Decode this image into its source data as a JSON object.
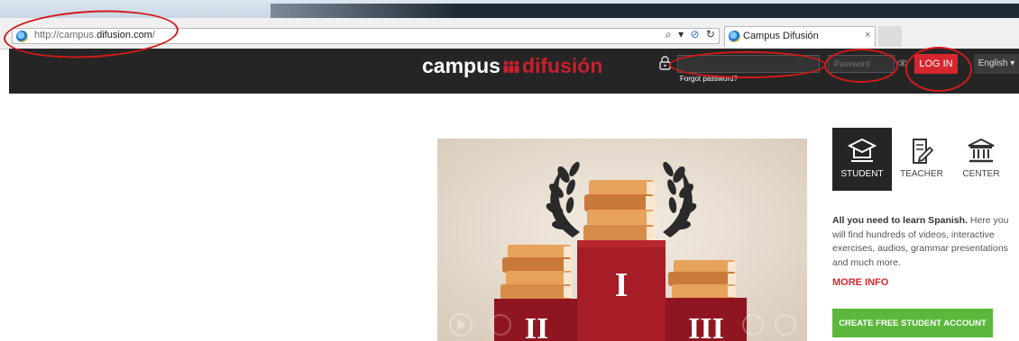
{
  "browser": {
    "url_prefix": "http://campus.",
    "url_domain": "difusion.com",
    "url_suffix": "/",
    "tab_title": "Campus Difusión",
    "search_glyph": "⌕",
    "dropdown_glyph": "▾",
    "stop_glyph": "⊘",
    "refresh_glyph": "↻",
    "close_glyph": "×"
  },
  "header": {
    "logo_part1": "campus",
    "logo_part2": "difusión",
    "username_placeholder": "",
    "forgot_password": "Forgot password?",
    "password_placeholder": "Password",
    "login_label": "LOG IN",
    "language_label": "English ▾"
  },
  "roles": [
    {
      "label": "STUDENT",
      "icon": "graduation-cap-icon",
      "active": true
    },
    {
      "label": "TEACHER",
      "icon": "pencil-document-icon",
      "active": false
    },
    {
      "label": "CENTER",
      "icon": "institution-icon",
      "active": false
    }
  ],
  "panel": {
    "desc_bold": "All you need to learn Spanish.",
    "desc_rest": " Here you will find hundreds of videos, interactive exercises, audios, grammar presentations and much more.",
    "more_info": "MORE INFO",
    "create_button": "CREATE FREE STUDENT ACCOUNT"
  },
  "video": {
    "podium_numerals": [
      "I",
      "II",
      "III"
    ]
  },
  "colors": {
    "brand_red": "#d8262e",
    "header_bg": "#252525",
    "cta_green": "#5cb83d",
    "annotation_red": "#d21a1a"
  }
}
